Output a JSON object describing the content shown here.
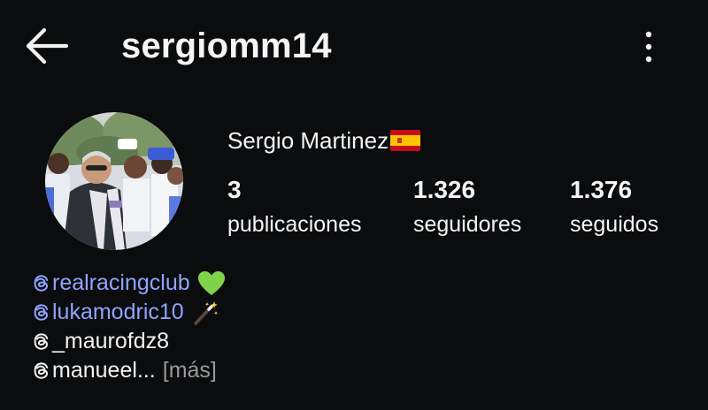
{
  "header": {
    "username": "sergiomm14"
  },
  "profile": {
    "full_name": "Sergio Martinez",
    "flag": "spain-flag-icon"
  },
  "stats": [
    {
      "count": "3",
      "label": "publicaciones"
    },
    {
      "count": "1.326",
      "label": "seguidores"
    },
    {
      "count": "1.376",
      "label": "seguidos"
    }
  ],
  "bio": {
    "lines": [
      {
        "text": "realracingclub",
        "emoji": "green-heart-icon",
        "style": "link"
      },
      {
        "text": "lukamodric10",
        "emoji": "magic-wand-icon",
        "style": "link"
      },
      {
        "text": "_maurofdz8",
        "style": "plain"
      },
      {
        "text": "manueel...",
        "style": "plain"
      }
    ],
    "more_label": "[más]"
  },
  "colors": {
    "background": "#0b0c0e",
    "link": "#8fa4ff",
    "text": "#f5f5f5",
    "muted": "#9a9a9a"
  }
}
